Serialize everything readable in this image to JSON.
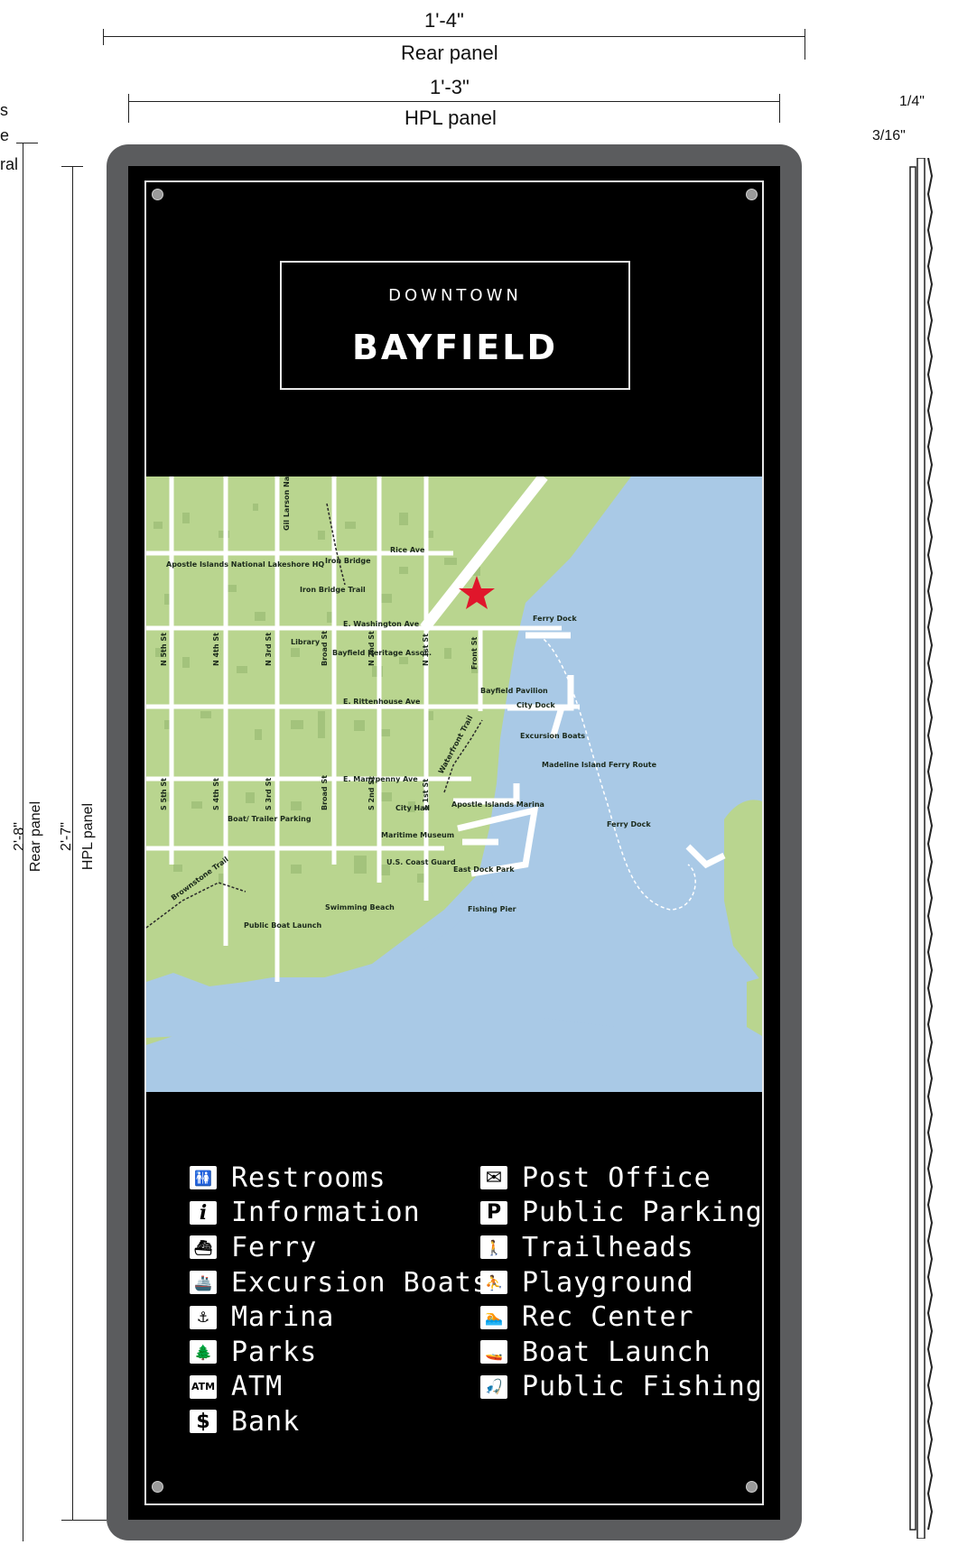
{
  "dimensions": {
    "rear_width": "1'-4\"",
    "rear_width_label": "Rear panel",
    "hpl_width": "1'-3\"",
    "hpl_width_label": "HPL panel",
    "rear_height": "2'-8\"",
    "rear_height_label": "Rear panel",
    "hpl_height": "2'-7\"",
    "hpl_height_label": "HPL panel",
    "side_quarter": "1/4\"",
    "side_3_16": "3/16\"",
    "cut_left_1": "s",
    "cut_left_2": "e",
    "cut_left_3": "ral"
  },
  "sign": {
    "title_small": "DOWNTOWN",
    "title_large": "BAYFIELD",
    "colors": {
      "land": "#b9d58f",
      "water": "#a9c9e6",
      "roads": "#ffffff",
      "blocks": "#a3c37c",
      "panel": "#000000",
      "frame": "#5b5c5e",
      "star": "#e0162b"
    }
  },
  "map_labels": {
    "gil_larson": "Gil Larson Nature Trail",
    "rice_ave": "Rice Ave",
    "iron_bridge": "Iron Bridge",
    "apostle_hq": "Apostle Islands National Lakeshore HQ",
    "iron_bridge_trail": "Iron Bridge Trail",
    "e_washington": "E. Washington Ave",
    "ferry_dock": "Ferry Dock",
    "library": "Library",
    "heritage": "Bayfield Heritage Assoc.",
    "n5": "N 5th St",
    "n4": "N 4th St",
    "n3": "N 3rd St",
    "broad_n": "Broad St",
    "n2": "N 2nd St",
    "n1": "N 1st St",
    "front": "Front St",
    "pavilion": "Bayfield Pavilion",
    "city_dock": "City Dock",
    "rittenhouse": "E. Rittenhouse Ave",
    "excursion": "Excursion Boats",
    "waterfront": "Waterfront Trail",
    "madeline": "Madeline Island Ferry Route",
    "manypenny": "E. Manypenny Ave",
    "apostle_marina": "Apostle Islands Marina",
    "s5": "S 5th St",
    "s4": "S 4th St",
    "s3": "S 3rd St",
    "broad_s": "Broad St",
    "s2": "S 2nd St",
    "s1": "S 1st St",
    "city_hall": "City Hall",
    "boat_trailer": "Boat/ Trailer Parking",
    "maritime": "Maritime Museum",
    "ferry_dock_right": "Ferry Dock",
    "coast_guard": "U.S. Coast Guard",
    "east_dock": "East Dock Park",
    "brownstone": "Brownstone Trail",
    "swimming": "Swimming Beach",
    "fishing_pier": "Fishing Pier",
    "public_boat": "Public Boat Launch"
  },
  "legend": {
    "left": [
      {
        "icon": "restrooms-icon",
        "glyph": "🚻",
        "label": "Restrooms"
      },
      {
        "icon": "information-icon",
        "glyph": "i",
        "label": "Information"
      },
      {
        "icon": "ferry-icon",
        "glyph": "⛴",
        "label": "Ferry"
      },
      {
        "icon": "excursion-boats-icon",
        "glyph": "🚢",
        "label": "Excursion Boats"
      },
      {
        "icon": "marina-icon",
        "glyph": "⚓",
        "label": "Marina"
      },
      {
        "icon": "parks-icon",
        "glyph": "🌲",
        "label": "Parks"
      },
      {
        "icon": "atm-icon",
        "glyph": "ATM",
        "label": "ATM"
      },
      {
        "icon": "bank-icon",
        "glyph": "$",
        "label": "Bank"
      }
    ],
    "right": [
      {
        "icon": "post-office-icon",
        "glyph": "✉",
        "label": "Post Office"
      },
      {
        "icon": "parking-icon",
        "glyph": "P",
        "label": "Public Parking"
      },
      {
        "icon": "trailheads-icon",
        "glyph": "🚶",
        "label": "Trailheads"
      },
      {
        "icon": "playground-icon",
        "glyph": "⛹",
        "label": "Playground"
      },
      {
        "icon": "rec-center-icon",
        "glyph": "🏊",
        "label": "Rec Center"
      },
      {
        "icon": "boat-launch-icon",
        "glyph": "🚤",
        "label": "Boat Launch"
      },
      {
        "icon": "fishing-icon",
        "glyph": "🎣",
        "label": "Public Fishing"
      }
    ]
  }
}
